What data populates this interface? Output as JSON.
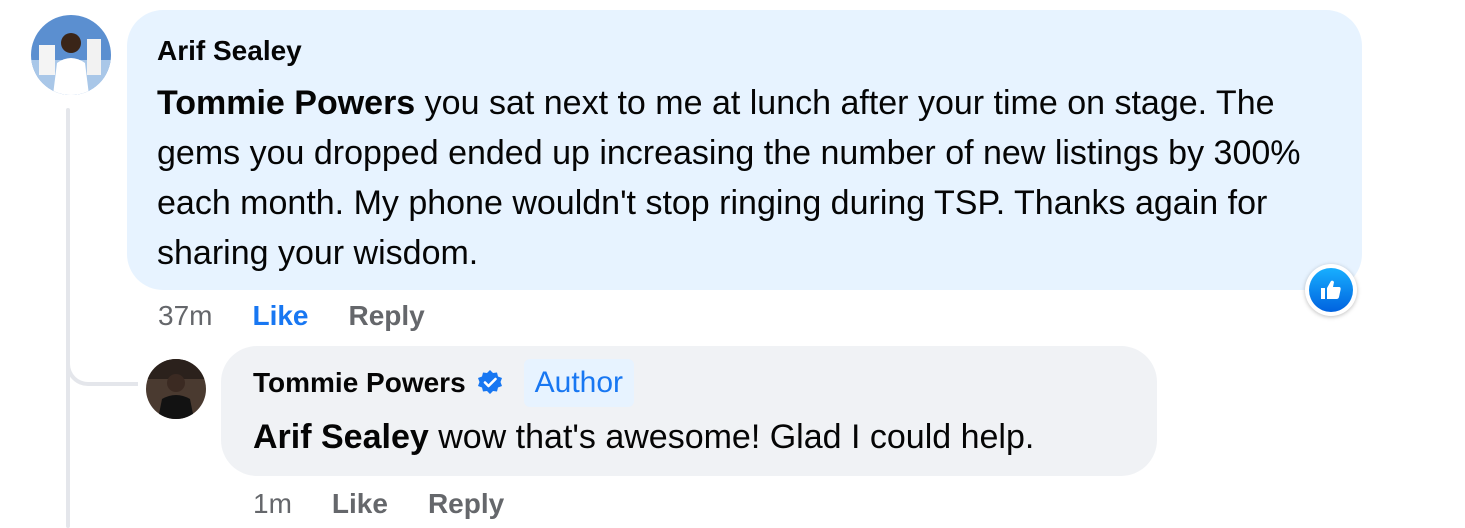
{
  "comments": [
    {
      "author": "Arif Sealey",
      "mention": "Tommie Powers",
      "text": " you sat next to me at lunch after your time on stage. The gems you dropped ended up increasing the number of new listings by 300% each month. My phone wouldn't stop ringing during TSP. Thanks again for sharing your wisdom.",
      "timestamp": "37m",
      "like_label": "Like",
      "reply_label": "Reply",
      "liked": true,
      "reaction_icon": "like-reaction-icon"
    }
  ],
  "reply": {
    "author": "Tommie Powers",
    "verified": true,
    "badge": "Author",
    "mention": "Arif Sealey",
    "text": " wow that's awesome! Glad I could help.",
    "timestamp": "1m",
    "like_label": "Like",
    "reply_label": "Reply",
    "liked": false
  },
  "colors": {
    "comment_bubble": "#e7f3ff",
    "reply_bubble": "#f0f2f5",
    "accent": "#1877f2",
    "secondary_text": "#65676b",
    "thread_line": "#e4e6eb"
  }
}
